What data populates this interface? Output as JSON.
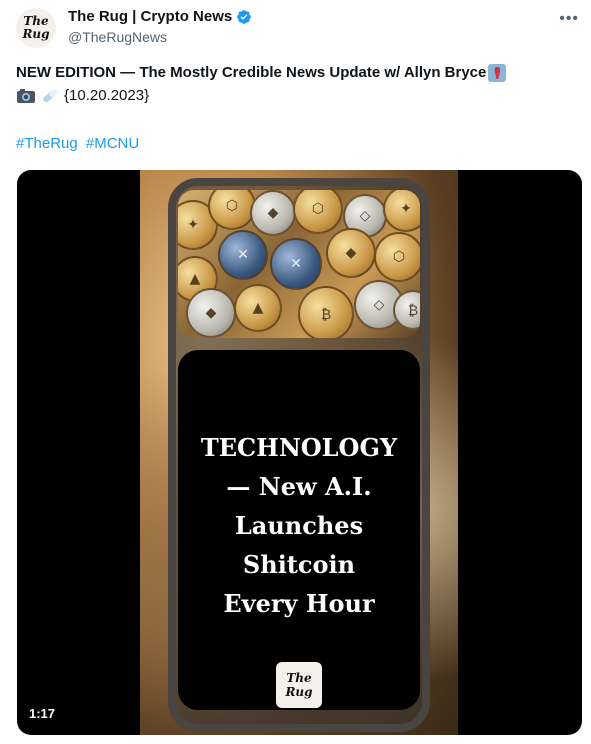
{
  "author": {
    "name": "The Rug | Crypto News",
    "handle": "@TheRugNews",
    "avatar_text": [
      "The",
      "Rug"
    ],
    "verified_color": "#1d9bf0"
  },
  "post": {
    "line1": "NEW EDITION — The Mostly Credible News Update w/ Allyn Bryce",
    "line1_emoji": "necktie-emoji",
    "line2_date": "{10.20.2023}",
    "line2_emojis": [
      "camera-emoji",
      "pill-emoji"
    ],
    "hashtags": [
      "#TheRug",
      "#MCNU"
    ]
  },
  "media": {
    "headline_lines": [
      "TECHNOLOGY",
      "— New A.I.",
      "Launches Shitcoin",
      "Every Hour"
    ],
    "logo_text": [
      "The",
      "Rug"
    ],
    "duration": "1:17"
  },
  "more_icon": "more-horizontal-icon"
}
